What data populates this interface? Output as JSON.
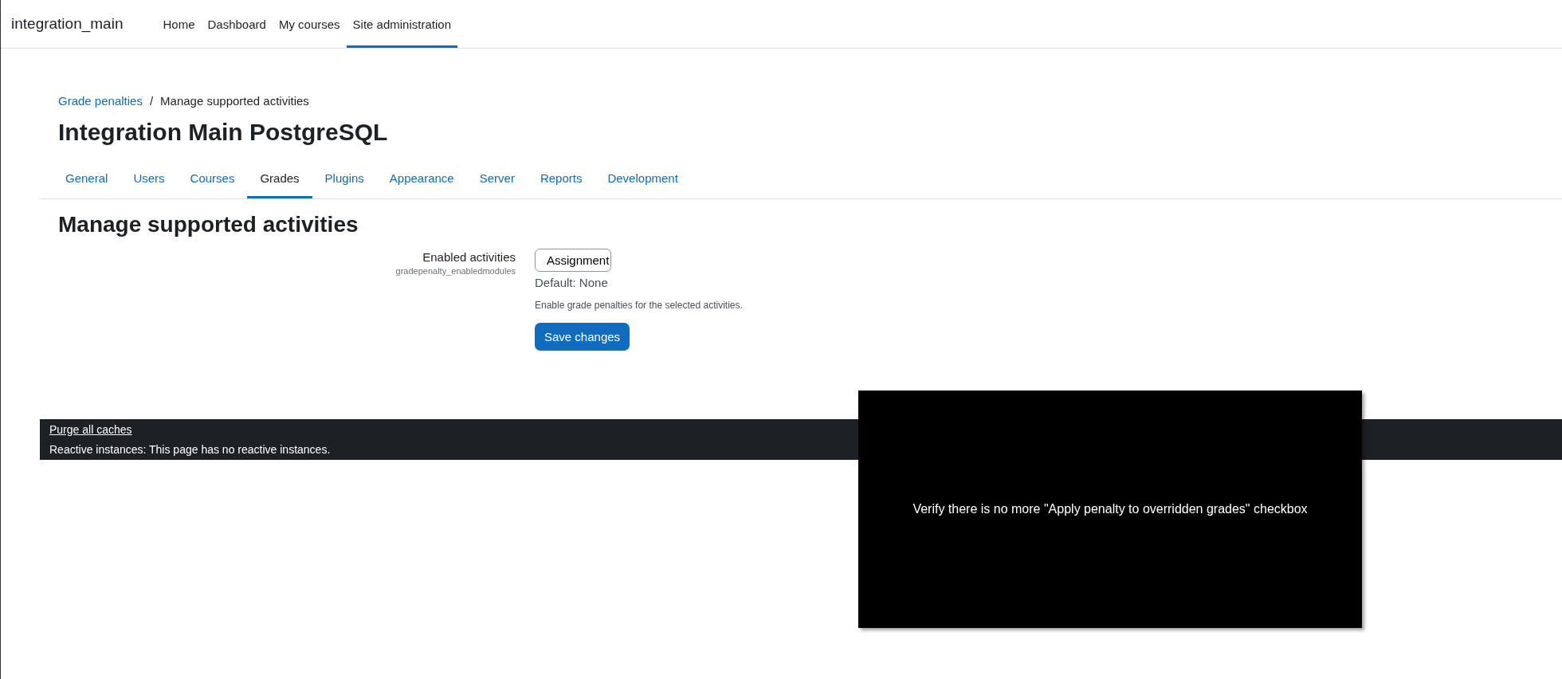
{
  "navbar": {
    "brand": "integration_main",
    "items": [
      {
        "label": "Home",
        "selected": false
      },
      {
        "label": "Dashboard",
        "selected": false
      },
      {
        "label": "My courses",
        "selected": false
      },
      {
        "label": "Site administration",
        "selected": true
      }
    ]
  },
  "breadcrumb": {
    "separator": "/",
    "items": [
      {
        "label": "Grade penalties",
        "kind": "link"
      },
      {
        "label": "Manage supported activities",
        "kind": "current"
      }
    ]
  },
  "page_title": "Integration Main PostgreSQL",
  "tabs": [
    {
      "label": "General",
      "selected": false
    },
    {
      "label": "Users",
      "selected": false
    },
    {
      "label": "Courses",
      "selected": false
    },
    {
      "label": "Grades",
      "selected": true
    },
    {
      "label": "Plugins",
      "selected": false
    },
    {
      "label": "Appearance",
      "selected": false
    },
    {
      "label": "Server",
      "selected": false
    },
    {
      "label": "Reports",
      "selected": false
    },
    {
      "label": "Development",
      "selected": false
    }
  ],
  "section_heading": "Manage supported activities",
  "setting": {
    "label": "Enabled activities",
    "name": "gradepenalty_enabledmodules",
    "options": [
      {
        "label": "Assignment"
      }
    ],
    "default": "Default: None",
    "description": "Enable grade penalties for the selected activities."
  },
  "save_button": "Save changes",
  "footer": {
    "link": "Purge all caches",
    "text": "Reactive instances: This page has no reactive instances."
  },
  "overlay": {
    "text": "Verify there is no more \"Apply penalty to overridden grades\" checkbox"
  }
}
